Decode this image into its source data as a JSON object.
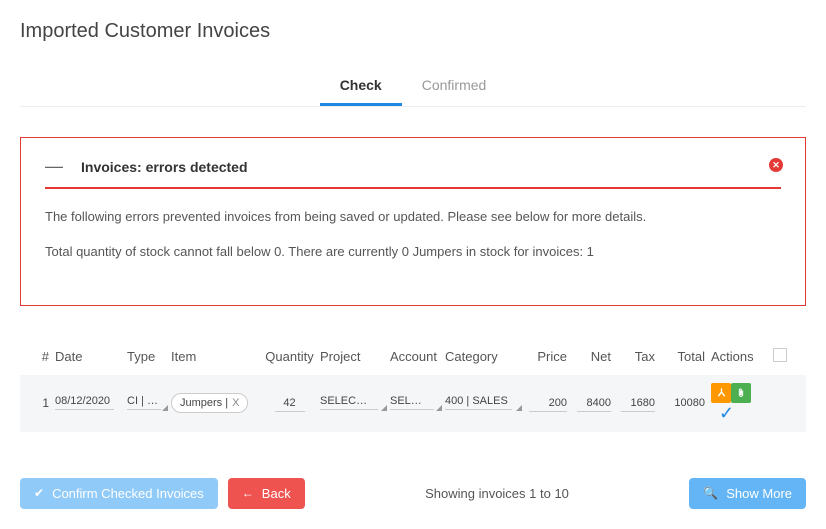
{
  "page_title": "Imported Customer Invoices",
  "tabs": {
    "check": "Check",
    "confirmed": "Confirmed",
    "active": "check"
  },
  "error_panel": {
    "title": "Invoices: errors detected",
    "line1": "The following errors prevented invoices from being saved or updated. Please see below for more details.",
    "line2": "Total quantity of stock cannot fall below 0. There are currently 0 Jumpers in stock for invoices: 1"
  },
  "columns": {
    "num": "#",
    "date": "Date",
    "type": "Type",
    "item": "Item",
    "qty": "Quantity",
    "project": "Project",
    "account": "Account",
    "category": "Category",
    "price": "Price",
    "net": "Net",
    "tax": "Tax",
    "total": "Total",
    "actions": "Actions"
  },
  "row": {
    "num": "1",
    "date": "08/12/2020",
    "type": "CI | …",
    "item_chip": "Jumpers |",
    "item_chip_x": "X",
    "qty": "42",
    "project": "SELEC…",
    "account": "SEL…",
    "category": "400 | SALES",
    "price": "200",
    "net": "8400",
    "tax": "1680",
    "total": "10080"
  },
  "footer": {
    "confirm": "Confirm Checked Invoices",
    "back": "Back",
    "status": "Showing invoices 1 to 10",
    "show_more": "Show More"
  }
}
